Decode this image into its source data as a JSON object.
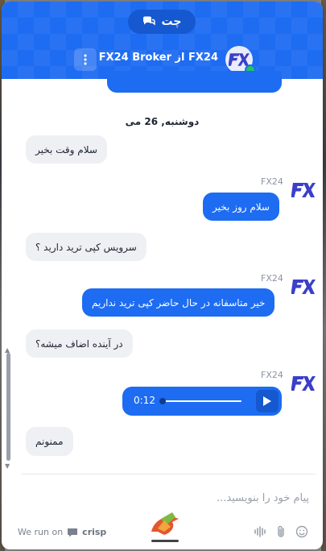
{
  "header": {
    "tab_label": "چت",
    "title": "FX24 از FX24 Broker"
  },
  "messages": {
    "date": "دوشنبه, 26 می",
    "items": [
      {
        "text": "سلام وقت بخیر"
      },
      {
        "sender": "FX24",
        "text": "سلام روز بخیر"
      },
      {
        "text": "سرویس کپی ترید دارید ؟"
      },
      {
        "sender": "FX24",
        "text": "خیر متاسفانه در حال حاضر کپی ترید نداریم"
      },
      {
        "text": "در آینده اضاف میشه؟"
      },
      {
        "sender": "FX24",
        "audio_time": "0:12"
      },
      {
        "text": "ممنونم"
      }
    ]
  },
  "composer": {
    "placeholder": "پیام خود را بنویسید..."
  },
  "footer": {
    "we_run_on": "We run on",
    "brand": "crisp"
  },
  "colors": {
    "primary": "#1d6cf2",
    "incoming_bubble": "#eef0f3",
    "logo": "#3b3fc9",
    "online": "#22c55e"
  }
}
